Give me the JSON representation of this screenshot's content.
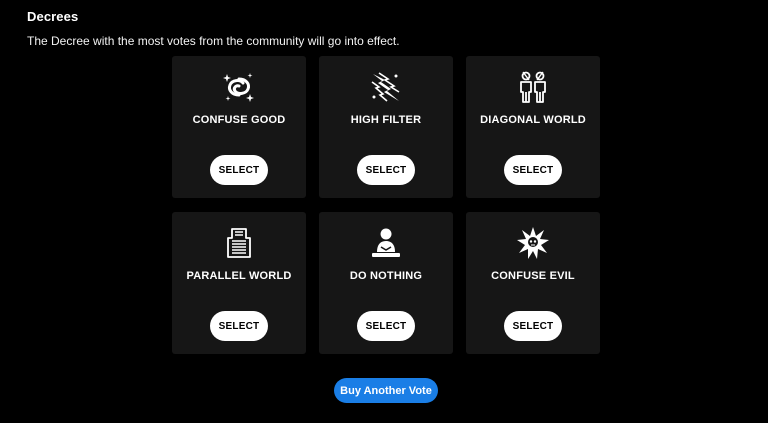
{
  "header": {
    "title": "Decrees",
    "subtitle": "The Decree with the most votes from the community will go into effect."
  },
  "decrees": [
    {
      "name": "CONFUSE GOOD",
      "icon": "swirl-stars-icon",
      "button": "SELECT"
    },
    {
      "name": "HIGH FILTER",
      "icon": "lightning-spark-icon",
      "button": "SELECT"
    },
    {
      "name": "DIAGONAL WORLD",
      "icon": "two-people-icon",
      "button": "SELECT"
    },
    {
      "name": "PARALLEL WORLD",
      "icon": "parallel-figure-icon",
      "button": "SELECT"
    },
    {
      "name": "DO NOTHING",
      "icon": "meditating-person-icon",
      "button": "SELECT"
    },
    {
      "name": "CONFUSE EVIL",
      "icon": "explosion-skull-icon",
      "button": "SELECT"
    }
  ],
  "footer": {
    "buy_label": "Buy Another Vote"
  },
  "colors": {
    "background": "#000000",
    "card": "#161616",
    "button": "#ffffff",
    "accent": "#1a7ee6"
  }
}
